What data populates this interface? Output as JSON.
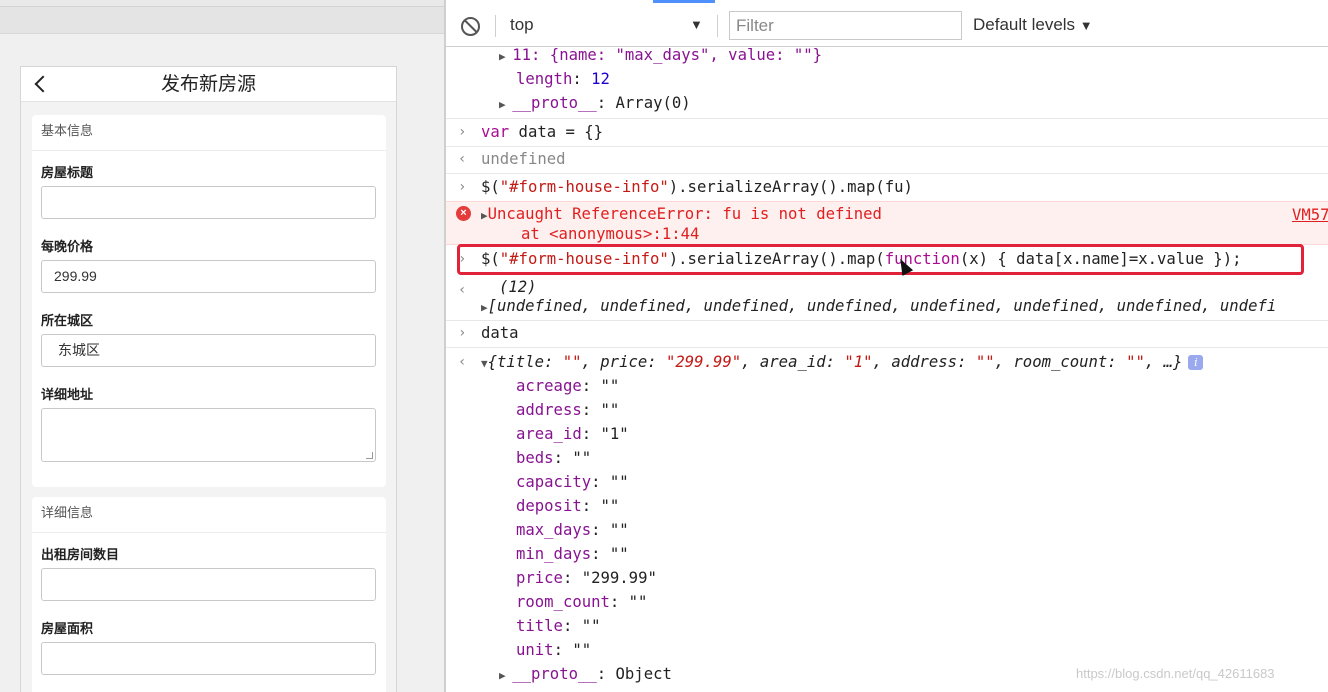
{
  "mobile": {
    "nav_title": "发布新房源",
    "section_basic": {
      "header": "基本信息",
      "title_label": "房屋标题",
      "title_value": "",
      "price_label": "每晚价格",
      "price_value": "299.99",
      "area_label": "所在城区",
      "area_value": "东城区",
      "address_label": "详细地址",
      "address_value": ""
    },
    "section_detail": {
      "header": "详细信息",
      "room_count_label": "出租房间数目",
      "room_count_value": "",
      "acreage_label": "房屋面积",
      "acreage_value": ""
    }
  },
  "devtools": {
    "toolbar": {
      "context": "top",
      "filter_placeholder": "Filter",
      "levels": "Default levels"
    },
    "console": {
      "arr_item_11": "11: {name: \"max_days\", value: \"\"}",
      "length_key": "length",
      "length_val": "12",
      "proto_key": "__proto__",
      "proto_val": "Array(0)",
      "cmd1_kw": "var",
      "cmd1_rest": " data = {}",
      "res1": "undefined",
      "cmd2_a": "$(",
      "cmd2_str": "\"#form-house-info\"",
      "cmd2_b": ").serializeArray().map(fu)",
      "err_line1": "Uncaught ReferenceError: fu is not defined",
      "err_line2": "at <anonymous>:1:44",
      "err_link": "VM57",
      "cmd3_a": "$(",
      "cmd3_str": "\"#form-house-info\"",
      "cmd3_b": ").serializeArray().map(",
      "cmd3_kw": "function",
      "cmd3_c": "(x) { data[x.name]=x.value });",
      "res3_count": "(12)",
      "res3_body": "[undefined, undefined, undefined, undefined, undefined, undefined, undefined, undefi",
      "cmd4": "data",
      "obj_summary_a": "{title: ",
      "obj_summary_b": "\"\"",
      "obj_summary_c": ", price: ",
      "obj_summary_d": "\"299.99\"",
      "obj_summary_e": ", area_id: ",
      "obj_summary_f": "\"1\"",
      "obj_summary_g": ", address: ",
      "obj_summary_h": "\"\"",
      "obj_summary_i": ", room_count: ",
      "obj_summary_j": "\"\"",
      "obj_summary_k": ", …}",
      "props": [
        {
          "key": "acreage",
          "value": "\"\""
        },
        {
          "key": "address",
          "value": "\"\""
        },
        {
          "key": "area_id",
          "value": "\"1\""
        },
        {
          "key": "beds",
          "value": "\"\""
        },
        {
          "key": "capacity",
          "value": "\"\""
        },
        {
          "key": "deposit",
          "value": "\"\""
        },
        {
          "key": "max_days",
          "value": "\"\""
        },
        {
          "key": "min_days",
          "value": "\"\""
        },
        {
          "key": "price",
          "value": "\"299.99\""
        },
        {
          "key": "room_count",
          "value": "\"\""
        },
        {
          "key": "title",
          "value": "\"\""
        },
        {
          "key": "unit",
          "value": "\"\""
        }
      ],
      "obj_proto_key": "__proto__",
      "obj_proto_val": "Object"
    },
    "watermark": "https://blog.csdn.net/qq_42611683"
  }
}
